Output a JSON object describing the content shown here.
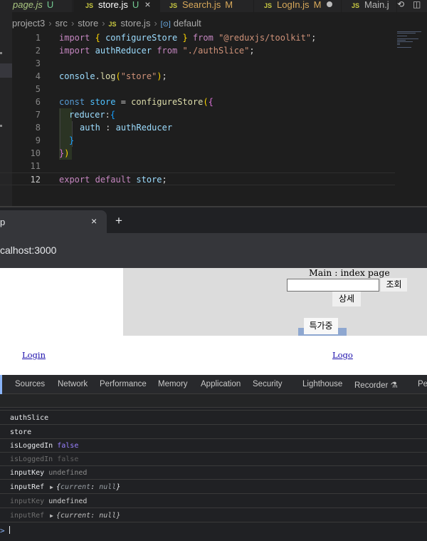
{
  "editor": {
    "tabs": [
      {
        "name": "page.js",
        "status": "U"
      },
      {
        "name": "store.js",
        "status": "U"
      },
      {
        "name": "Search.js",
        "status": "M"
      },
      {
        "name": "LogIn.js",
        "status": "M"
      },
      {
        "name": "Main.j",
        "status": ""
      }
    ],
    "breadcrumb": [
      "project3",
      "src",
      "store",
      "store.js",
      "default"
    ],
    "line_numbers": [
      "1",
      "2",
      "3",
      "4",
      "5",
      "6",
      "7",
      "8",
      "9",
      "10",
      "11",
      "12"
    ],
    "code": {
      "l1": {
        "import": "import",
        "open": "{",
        "name": "configureStore",
        "close": "}",
        "from": "from",
        "path": "\"@reduxjs/toolkit\"",
        "semi": ";"
      },
      "l2": {
        "import": "import",
        "name": "authReducer",
        "from": "from",
        "path": "\"./authSlice\"",
        "semi": ";"
      },
      "l4": {
        "obj": "console",
        "dot": ".",
        "fn": "log",
        "open": "(",
        "str": "\"store\"",
        "close": ")",
        "semi": ";"
      },
      "l6": {
        "const": "const",
        "name": "store",
        "eq": " = ",
        "fn": "configureStore",
        "open": "(",
        "brace": "{"
      },
      "l7": {
        "key": "reducer",
        "colon": ":",
        "brace": "{"
      },
      "l8": {
        "key": "auth",
        "colon": " : ",
        "val": "authReducer"
      },
      "l9": {
        "brace": "}"
      },
      "l10": {
        "brace": "}",
        "paren": ")"
      },
      "l12": {
        "export": "export",
        "default": "default",
        "name": "store",
        "semi": ";"
      }
    }
  },
  "browser": {
    "tab_title": "p",
    "close_glyph": "×",
    "new_tab_glyph": "+",
    "url": "calhost:3000",
    "page": {
      "main_title": "Main : index page",
      "search_value": "",
      "search_button": "조회",
      "detail_button": "상세",
      "promo_button": "특가중",
      "login_link": "Login",
      "logo_link": "Logo"
    }
  },
  "devtools": {
    "tabs": [
      "Sources",
      "Network",
      "Performance",
      "Memory",
      "Application",
      "Security",
      "Lighthouse",
      "Recorder",
      "Pe"
    ],
    "console_rows": [
      {
        "text": "authSlice",
        "value": ""
      },
      {
        "text": "store",
        "value": ""
      },
      {
        "text": "isLoggedIn",
        "value": "false"
      },
      {
        "text": "isLoggedIn",
        "value": "false"
      },
      {
        "text": "inputKey",
        "value": "undefined"
      },
      {
        "text": "inputRef",
        "obj": {
          "key": "current",
          "val": "null"
        }
      },
      {
        "text": "inputKey",
        "value": "undefined"
      },
      {
        "text": "inputRef",
        "obj": {
          "key": "current",
          "val": "null"
        }
      }
    ],
    "prompt": ">"
  },
  "colors": {
    "editor_bg": "#1e1e1e",
    "keyword": "#c586c0",
    "string": "#ce9178",
    "function": "#dcdcaa",
    "variable": "#9cdcfe",
    "console_boolean": "#9980ff",
    "link": "#1a0dab"
  }
}
